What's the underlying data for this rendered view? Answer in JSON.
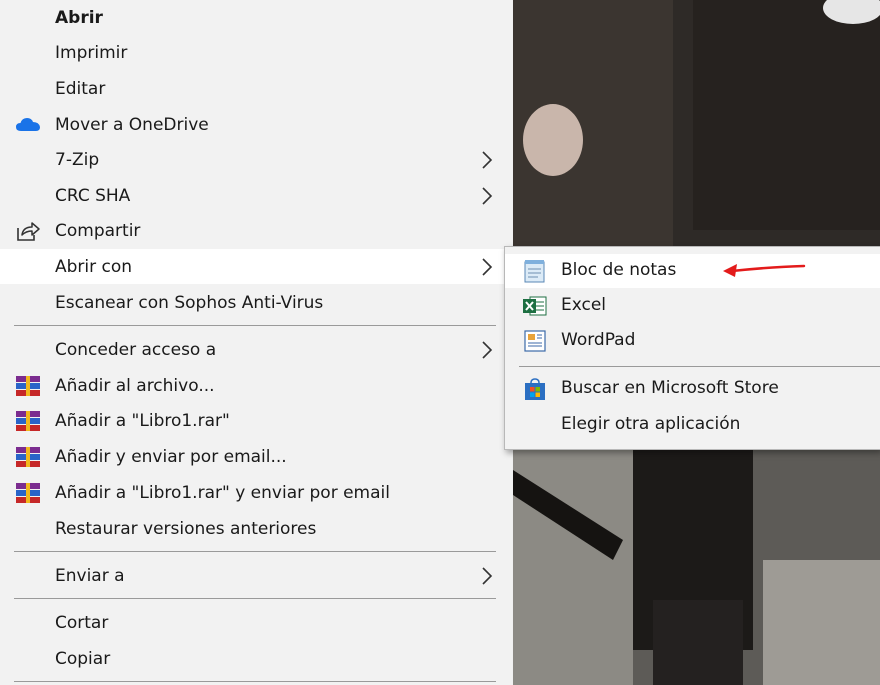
{
  "main_menu": {
    "items": [
      {
        "label": "Abrir",
        "bold": true,
        "icon": "",
        "has_submenu": false
      },
      {
        "label": "Imprimir",
        "icon": "",
        "has_submenu": false
      },
      {
        "label": "Editar",
        "icon": "",
        "has_submenu": false
      },
      {
        "label": "Mover a OneDrive",
        "icon": "onedrive-icon",
        "has_submenu": false
      },
      {
        "label": "7-Zip",
        "icon": "",
        "has_submenu": true
      },
      {
        "label": "CRC SHA",
        "icon": "",
        "has_submenu": true
      },
      {
        "label": "Compartir",
        "icon": "share-icon",
        "has_submenu": false
      },
      {
        "label": "Abrir con",
        "icon": "",
        "has_submenu": true,
        "highlighted": true
      },
      {
        "label": "Escanear con Sophos Anti-Virus",
        "icon": "",
        "has_submenu": false
      },
      {
        "label": "Conceder acceso a",
        "icon": "",
        "has_submenu": true
      },
      {
        "label": "Añadir al archivo...",
        "icon": "winrar-icon",
        "has_submenu": false
      },
      {
        "label": "Añadir a \"Libro1.rar\"",
        "icon": "winrar-icon",
        "has_submenu": false
      },
      {
        "label": "Añadir y enviar por email...",
        "icon": "winrar-icon",
        "has_submenu": false
      },
      {
        "label": "Añadir a \"Libro1.rar\" y enviar por email",
        "icon": "winrar-icon",
        "has_submenu": false
      },
      {
        "label": "Restaurar versiones anteriores",
        "icon": "",
        "has_submenu": false
      },
      {
        "label": "Enviar a",
        "icon": "",
        "has_submenu": true
      },
      {
        "label": "Cortar",
        "icon": "",
        "has_submenu": false
      },
      {
        "label": "Copiar",
        "icon": "",
        "has_submenu": false
      }
    ]
  },
  "open_with_submenu": {
    "items": [
      {
        "label": "Bloc de notas",
        "icon": "notepad-icon",
        "highlighted": true
      },
      {
        "label": "Excel",
        "icon": "excel-icon"
      },
      {
        "label": "WordPad",
        "icon": "wordpad-icon"
      },
      {
        "label": "Buscar en Microsoft Store",
        "icon": "microsoft-store-icon"
      },
      {
        "label": "Elegir otra aplicación",
        "icon": ""
      }
    ]
  },
  "colors": {
    "menu_bg": "#f2f2f2",
    "hover_bg": "#ffffff",
    "separator": "#9a9a9a",
    "annotation_arrow": "#e31b1b",
    "onedrive": "#1a73e8",
    "excel": "#1d6f42"
  }
}
